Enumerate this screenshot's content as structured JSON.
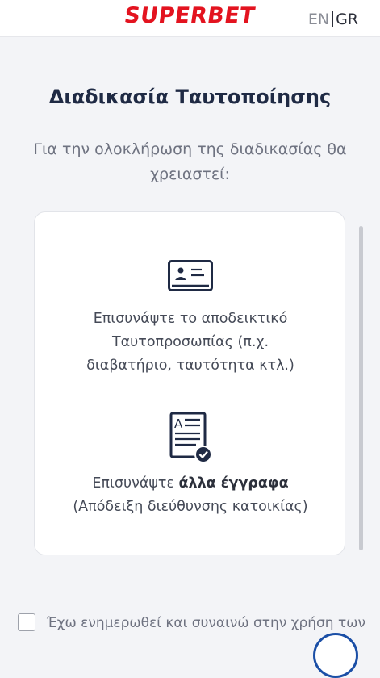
{
  "header": {
    "logo_text": "SUPERBET",
    "lang_en": "EN",
    "lang_gr": "GR"
  },
  "main": {
    "title": "Διαδικασία Ταυτοποίησης",
    "subtitle": "Για την ολοκλήρωση της διαδικασίας θα χρειαστεί:"
  },
  "requirements": {
    "id_doc": {
      "icon": "id-card-icon",
      "text_line1": "Επισυνάψτε το αποδεικτικό",
      "text_line2": "Ταυτοπροσωπίας (π.χ.",
      "text_line3": "διαβατήριο, ταυτότητα κτλ.)"
    },
    "other_doc": {
      "icon": "document-check-icon",
      "text_prefix": "Επισυνάψτε ",
      "text_bold": "άλλα έγγραφα",
      "text_line2": "(Απόδειξη διεύθυνσης κατοικίας)"
    }
  },
  "consent": {
    "text": "Έχω ενημερωθεί και συναινώ στην χρήση των"
  },
  "colors": {
    "brand": "#e3131f",
    "title": "#1f2a44",
    "accent": "#1b4fa6"
  }
}
